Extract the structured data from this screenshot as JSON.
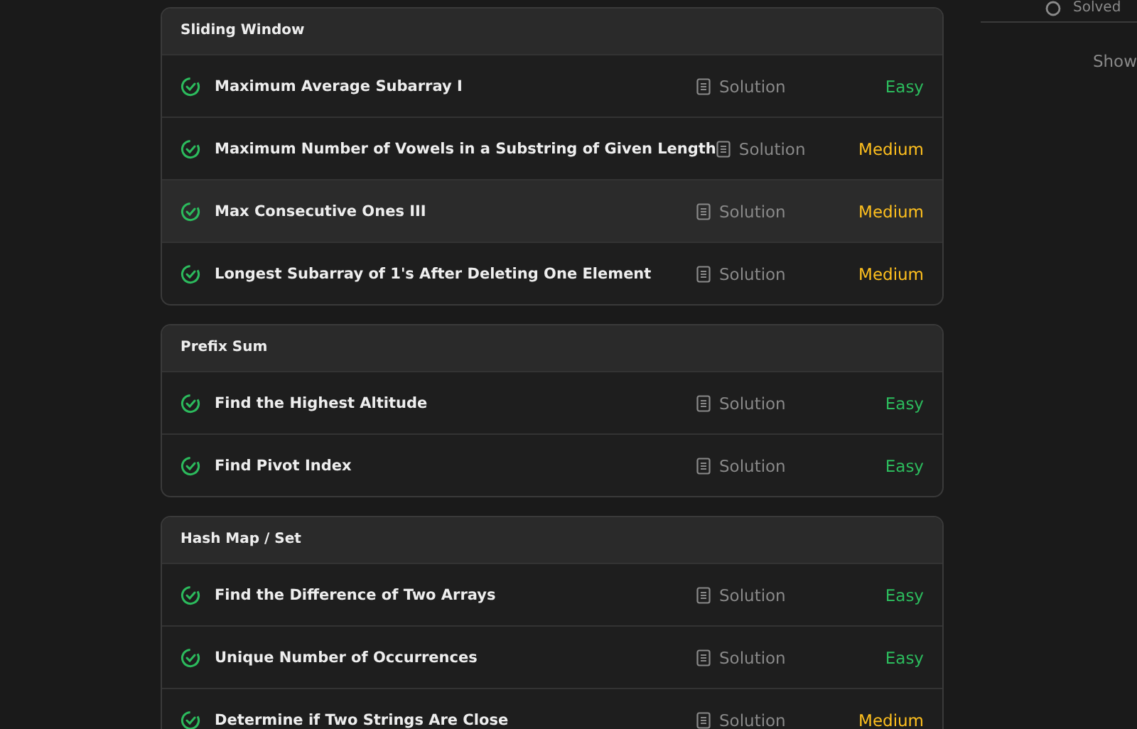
{
  "sections": [
    {
      "title": "Sliding Window",
      "problems": [
        {
          "title": "Maximum Average Subarray I",
          "solved": true,
          "hovered": false,
          "solution": "Solution",
          "difficulty": "Easy",
          "color": "#2cbb5d"
        },
        {
          "title": "Maximum Number of Vowels in a Substring of Given Length",
          "solved": true,
          "hovered": false,
          "solution": "Solution",
          "difficulty": "Medium",
          "color": "#ffc01e"
        },
        {
          "title": "Max Consecutive Ones III",
          "solved": true,
          "hovered": true,
          "solution": "Solution",
          "difficulty": "Medium",
          "color": "#ffc01e"
        },
        {
          "title": "Longest Subarray of 1's After Deleting One Element",
          "solved": true,
          "hovered": false,
          "solution": "Solution",
          "difficulty": "Medium",
          "color": "#ffc01e"
        }
      ]
    },
    {
      "title": "Prefix Sum",
      "problems": [
        {
          "title": "Find the Highest Altitude",
          "solved": true,
          "hovered": false,
          "solution": "Solution",
          "difficulty": "Easy",
          "color": "#2cbb5d"
        },
        {
          "title": "Find Pivot Index",
          "solved": true,
          "hovered": false,
          "solution": "Solution",
          "difficulty": "Easy",
          "color": "#2cbb5d"
        }
      ]
    },
    {
      "title": "Hash Map / Set",
      "problems": [
        {
          "title": "Find the Difference of Two Arrays",
          "solved": true,
          "hovered": false,
          "solution": "Solution",
          "difficulty": "Easy",
          "color": "#2cbb5d"
        },
        {
          "title": "Unique Number of Occurrences",
          "solved": true,
          "hovered": false,
          "solution": "Solution",
          "difficulty": "Easy",
          "color": "#2cbb5d"
        },
        {
          "title": "Determine if Two Strings Are Close",
          "solved": true,
          "hovered": false,
          "solution": "Solution",
          "difficulty": "Medium",
          "color": "#ffc01e"
        }
      ]
    }
  ],
  "side": {
    "solved_label": "Solved",
    "show_label": "Show"
  }
}
